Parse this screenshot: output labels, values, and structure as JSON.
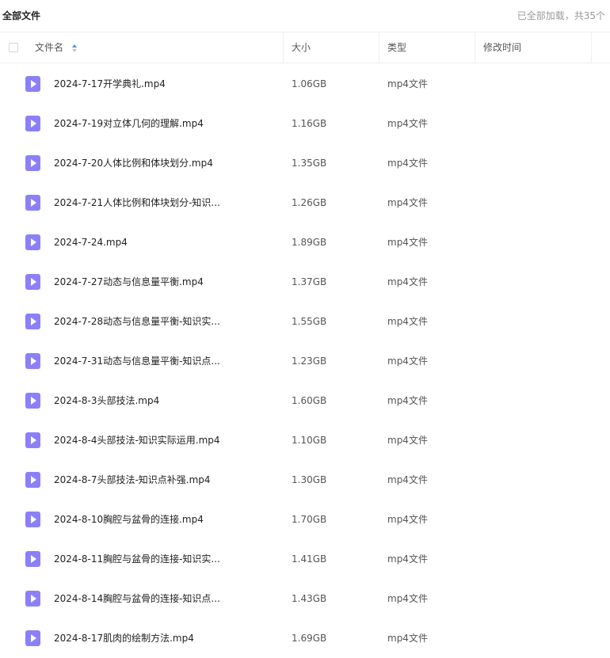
{
  "header_bar": {
    "title": "全部文件",
    "loaded_status": "已全部加载，共35个"
  },
  "columns": {
    "name": "文件名",
    "size": "大小",
    "type": "类型",
    "modified": "修改时间"
  },
  "colors": {
    "icon_purple": "#8b80f9",
    "border": "#eef0f3",
    "sort_blue": "#4a90e2"
  },
  "files": [
    {
      "name": "2024-7-17开学典礼.mp4",
      "size": "1.06GB",
      "type": "mp4文件"
    },
    {
      "name": "2024-7-19对立体几何的理解.mp4",
      "size": "1.16GB",
      "type": "mp4文件"
    },
    {
      "name": "2024-7-20人体比例和体块划分.mp4",
      "size": "1.35GB",
      "type": "mp4文件"
    },
    {
      "name": "2024-7-21人体比例和体块划分-知识...",
      "size": "1.26GB",
      "type": "mp4文件"
    },
    {
      "name": "2024-7-24.mp4",
      "size": "1.89GB",
      "type": "mp4文件"
    },
    {
      "name": "2024-7-27动态与信息量平衡.mp4",
      "size": "1.37GB",
      "type": "mp4文件"
    },
    {
      "name": "2024-7-28动态与信息量平衡-知识实...",
      "size": "1.55GB",
      "type": "mp4文件"
    },
    {
      "name": "2024-7-31动态与信息量平衡-知识点...",
      "size": "1.23GB",
      "type": "mp4文件"
    },
    {
      "name": "2024-8-3头部技法.mp4",
      "size": "1.60GB",
      "type": "mp4文件"
    },
    {
      "name": "2024-8-4头部技法-知识实际运用.mp4",
      "size": "1.10GB",
      "type": "mp4文件"
    },
    {
      "name": "2024-8-7头部技法-知识点补强.mp4",
      "size": "1.30GB",
      "type": "mp4文件"
    },
    {
      "name": "2024-8-10胸腔与盆骨的连接.mp4",
      "size": "1.70GB",
      "type": "mp4文件"
    },
    {
      "name": "2024-8-11胸腔与盆骨的连接-知识实...",
      "size": "1.41GB",
      "type": "mp4文件"
    },
    {
      "name": "2024-8-14胸腔与盆骨的连接-知识点...",
      "size": "1.43GB",
      "type": "mp4文件"
    },
    {
      "name": "2024-8-17肌肉的绘制方法.mp4",
      "size": "1.69GB",
      "type": "mp4文件"
    }
  ]
}
